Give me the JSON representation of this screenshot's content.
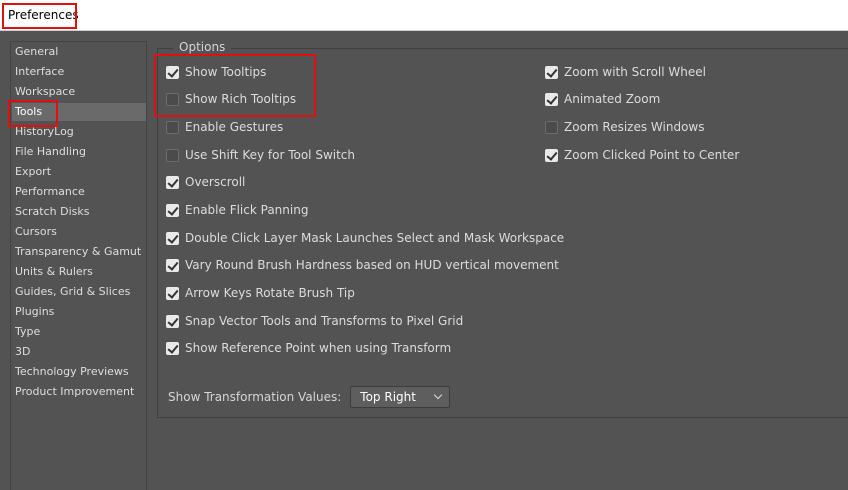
{
  "window": {
    "title": "Preferences"
  },
  "sidebar": {
    "items": [
      {
        "label": "General"
      },
      {
        "label": "Interface"
      },
      {
        "label": "Workspace"
      },
      {
        "label": "Tools",
        "selected": true
      },
      {
        "label": "HistoryLog"
      },
      {
        "label": "File Handling"
      },
      {
        "label": "Export"
      },
      {
        "label": "Performance"
      },
      {
        "label": "Scratch Disks"
      },
      {
        "label": "Cursors"
      },
      {
        "label": "Transparency & Gamut"
      },
      {
        "label": "Units & Rulers"
      },
      {
        "label": "Guides, Grid & Slices"
      },
      {
        "label": "Plugins"
      },
      {
        "label": "Type"
      },
      {
        "label": "3D"
      },
      {
        "label": "Technology Previews"
      },
      {
        "label": "Product Improvement"
      }
    ]
  },
  "options": {
    "group_label": "Options",
    "left": [
      {
        "label": "Show Tooltips",
        "checked": true
      },
      {
        "label": "Show Rich Tooltips",
        "checked": false
      },
      {
        "label": "Enable Gestures",
        "checked": false
      },
      {
        "label": "Use Shift Key for Tool Switch",
        "checked": false
      },
      {
        "label": "Overscroll",
        "checked": true
      },
      {
        "label": "Enable Flick Panning",
        "checked": true
      },
      {
        "label": "Double Click Layer Mask Launches Select and Mask Workspace",
        "checked": true
      },
      {
        "label": "Vary Round Brush Hardness based on HUD vertical movement",
        "checked": true
      },
      {
        "label": "Arrow Keys Rotate Brush Tip",
        "checked": true
      },
      {
        "label": "Snap Vector Tools and Transforms to Pixel Grid",
        "checked": true
      },
      {
        "label": "Show Reference Point when using Transform",
        "checked": true
      }
    ],
    "right": [
      {
        "label": "Zoom with Scroll Wheel",
        "checked": true
      },
      {
        "label": "Animated Zoom",
        "checked": true
      },
      {
        "label": "Zoom Resizes Windows",
        "checked": false
      },
      {
        "label": "Zoom Clicked Point to Center",
        "checked": true
      }
    ]
  },
  "transformation": {
    "label": "Show Transformation Values:",
    "selected": "Top Right"
  },
  "colors": {
    "highlight": "#e01010",
    "panel_bg": "#535353",
    "selected_item": "#6a6a6a"
  }
}
